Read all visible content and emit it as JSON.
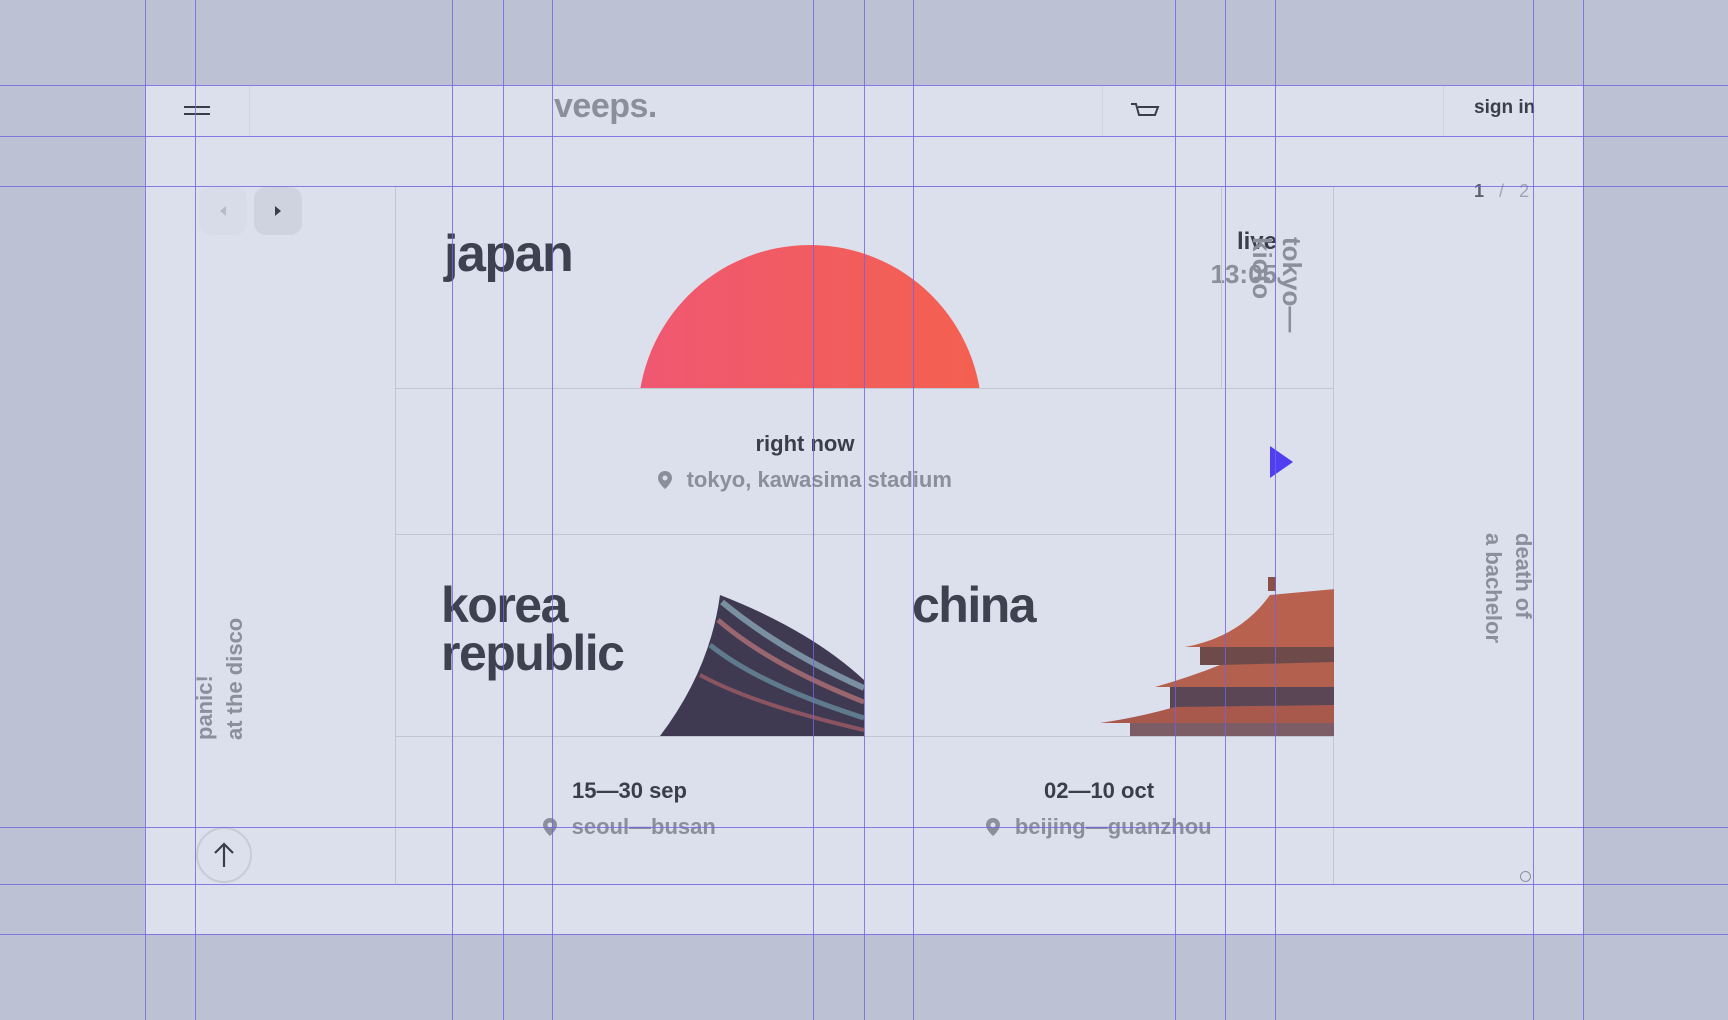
{
  "header": {
    "logo": "veeps.",
    "sign_in_label": "sign in",
    "menu_icon": "hamburger-menu-icon",
    "cart_icon": "cart-icon"
  },
  "pager": {
    "current": "1",
    "separator": "/",
    "total": "2"
  },
  "side_left": {
    "text_line1": "panic!",
    "text_line2": "at the disco"
  },
  "side_right": {
    "text_line1": "death of",
    "text_line2": "a bachelor"
  },
  "japan": {
    "title": "japan",
    "status": "live",
    "time": "13:05",
    "route_line1": "tokyo—",
    "route_line2": "kioto",
    "now_label": "right now",
    "location": "tokyo, kawasima stadium",
    "sun_color": "#f15b5b"
  },
  "korea": {
    "title_line1": "korea",
    "title_line2": "republic",
    "dates": "15—30 sep",
    "location": "seoul—busan"
  },
  "china": {
    "title": "china",
    "dates": "02—10 oct",
    "location": "beijing—guanzhou"
  },
  "colors": {
    "accent": "#4f3ff0",
    "background": "#dce0ec",
    "outer": "#bcc2d3"
  }
}
